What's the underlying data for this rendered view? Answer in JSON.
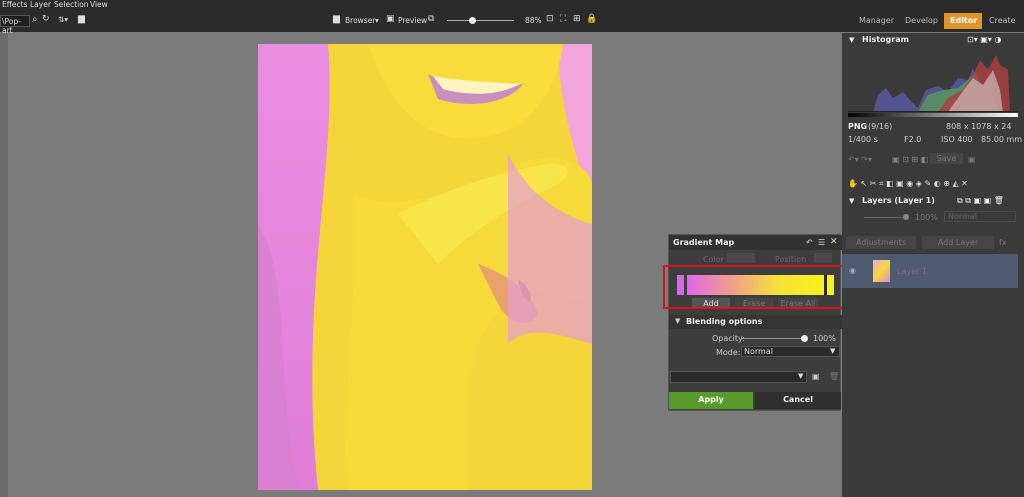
{
  "menu": {
    "items": [
      "Effects",
      "Layer",
      "Selection",
      "View"
    ]
  },
  "toolbar": {
    "preset": "\\Pop-art",
    "browser": "Browser",
    "preview": "Preview",
    "zoom": "88%",
    "modes": [
      "Manager",
      "Develop",
      "Editor",
      "Create"
    ],
    "active_mode": "Editor"
  },
  "histogram": {
    "title": "Histogram",
    "format": "PNG",
    "index": "(9/16)",
    "dimensions": "808 x 1078 x 24",
    "shutter": "1/400 s",
    "aperture": "F2.0",
    "iso": "ISO 400",
    "focal": "85.00 mm"
  },
  "history": {
    "save": "Save"
  },
  "layers": {
    "title": "Layers (Layer 1)",
    "opacity": "100%",
    "blend": "Normal",
    "adjustments": "Adjustments",
    "add_layer": "Add Layer",
    "layer_name": "Layer 1"
  },
  "gradient_map": {
    "title": "Gradient Map",
    "color_label": "Color",
    "position_label": "Position",
    "add": "Add",
    "erase": "Erase",
    "erase_all": "Erase All",
    "gradient_start": "#e066e8",
    "gradient_end": "#f8f21a",
    "blending_title": "Blending options",
    "opacity_label": "Opacity:",
    "opacity_value": "100%",
    "opacity_level": 1.0,
    "mode_label": "Mode:",
    "mode_value": "Normal",
    "apply": "Apply",
    "cancel": "Cancel"
  },
  "colors": {
    "accent": "#e2962a",
    "apply": "#5a9a2a",
    "highlight": "#d6141a"
  }
}
